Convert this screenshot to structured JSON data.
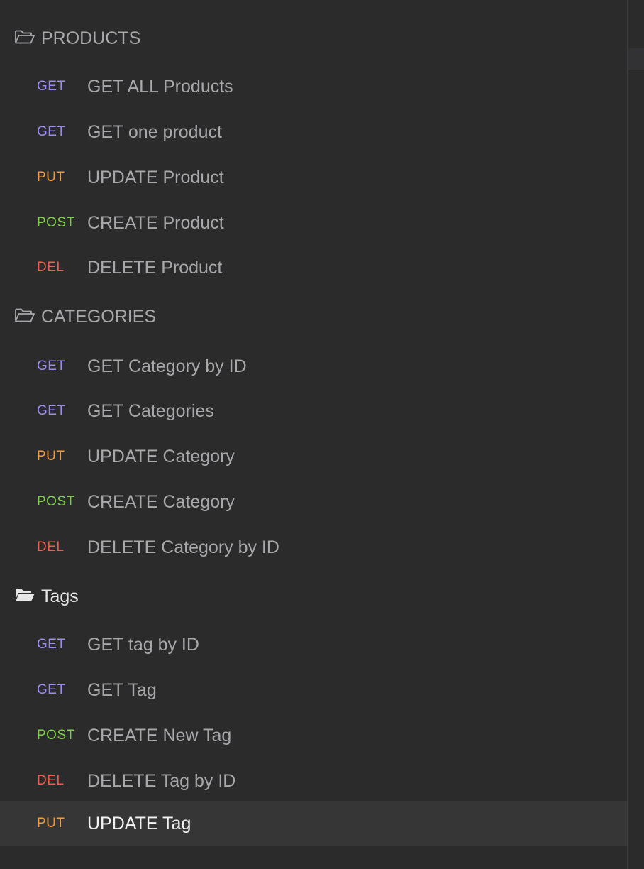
{
  "colors": {
    "background": "#2b2b2c",
    "active_row": "#363637",
    "GET": "#9d8cf0",
    "PUT": "#f19a3e",
    "POST": "#7fd14b",
    "DEL": "#ee5d4d"
  },
  "folders": [
    {
      "name": "PRODUCTS",
      "state": "collapsed-outline",
      "icon": "folder-open-outline-icon",
      "requests": [
        {
          "method": "GET",
          "name": "GET ALL Products"
        },
        {
          "method": "GET",
          "name": "GET one product"
        },
        {
          "method": "PUT",
          "name": "UPDATE Product"
        },
        {
          "method": "POST",
          "name": "CREATE Product"
        },
        {
          "method": "DEL",
          "name": "DELETE Product"
        }
      ]
    },
    {
      "name": "CATEGORIES",
      "state": "collapsed-outline",
      "icon": "folder-open-outline-icon",
      "requests": [
        {
          "method": "GET",
          "name": "GET Category by ID"
        },
        {
          "method": "GET",
          "name": "GET Categories"
        },
        {
          "method": "PUT",
          "name": "UPDATE Category"
        },
        {
          "method": "POST",
          "name": "CREATE Category"
        },
        {
          "method": "DEL",
          "name": "DELETE Category by ID"
        }
      ]
    },
    {
      "name": "Tags",
      "state": "open-filled",
      "icon": "folder-open-filled-icon",
      "requests": [
        {
          "method": "GET",
          "name": "GET tag by ID"
        },
        {
          "method": "GET",
          "name": "GET Tag"
        },
        {
          "method": "POST",
          "name": "CREATE New Tag"
        },
        {
          "method": "DEL",
          "name": "DELETE Tag by ID"
        },
        {
          "method": "PUT",
          "name": "UPDATE Tag",
          "active": true
        }
      ]
    }
  ]
}
